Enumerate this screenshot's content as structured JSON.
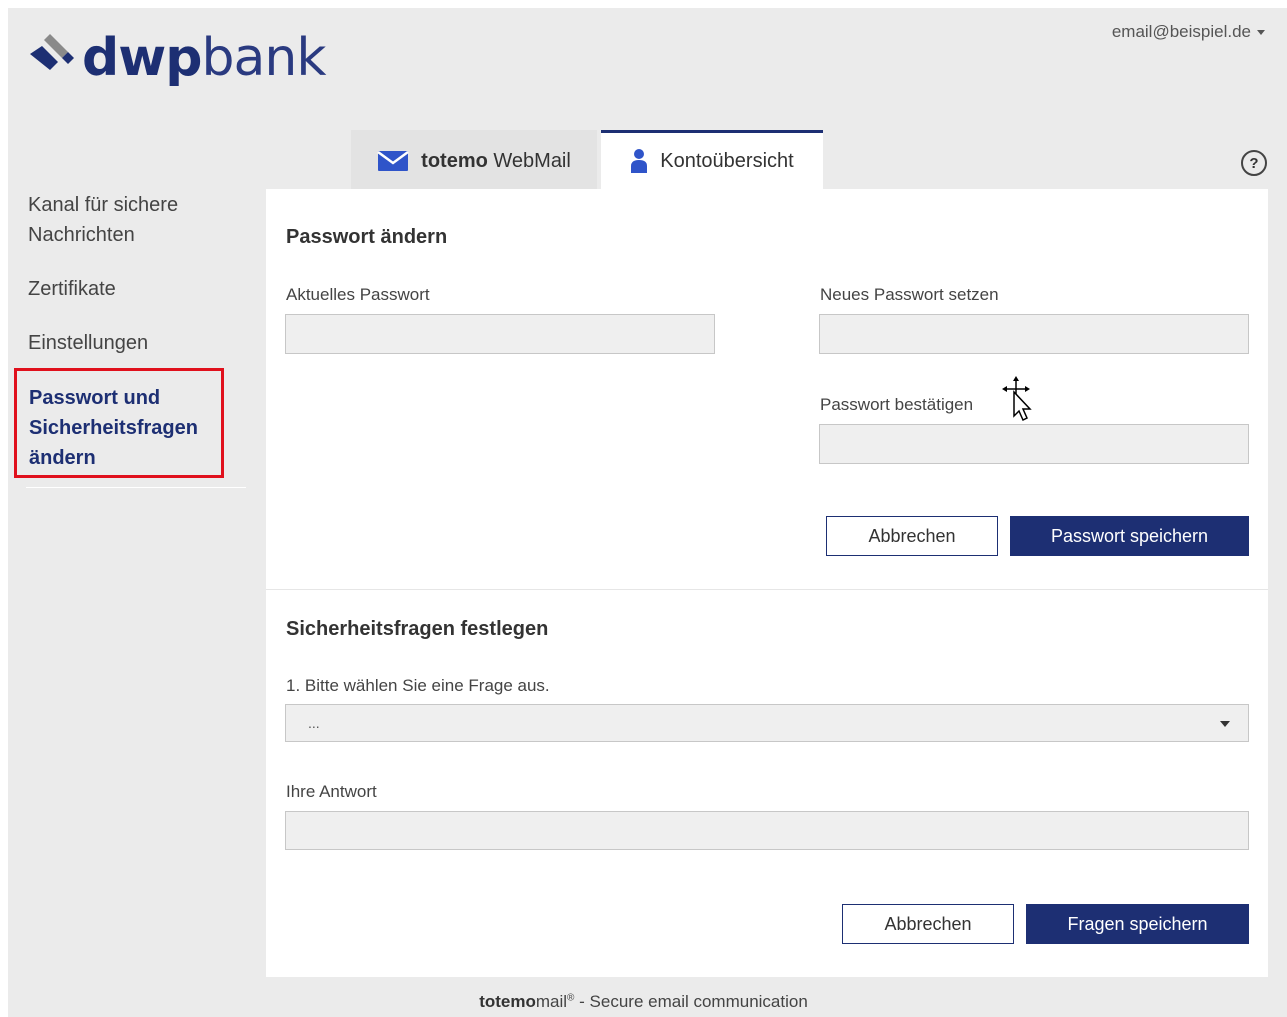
{
  "header": {
    "logo_bold": "dwp",
    "logo_light": "bank",
    "user_email": "email@beispiel.de"
  },
  "tabs": [
    {
      "bold": "totemo",
      "label": "WebMail",
      "icon": "envelope-icon"
    },
    {
      "label": "Kontoübersicht",
      "icon": "user-icon"
    }
  ],
  "help_label": "?",
  "sidebar": {
    "items": [
      {
        "label": "Kanal für sichere Nachrichten"
      },
      {
        "label": "Zertifikate"
      },
      {
        "label": "Einstellungen"
      },
      {
        "label": "Passwort und Sicherheitsfragen ändern"
      }
    ]
  },
  "password_section": {
    "title": "Passwort ändern",
    "current_label": "Aktuelles Passwort",
    "current_value": "",
    "new_label": "Neues Passwort setzen",
    "new_value": "",
    "confirm_label": "Passwort bestätigen",
    "confirm_value": "",
    "cancel_label": "Abbrechen",
    "save_label": "Passwort speichern"
  },
  "security_section": {
    "title": "Sicherheitsfragen festlegen",
    "question_label": "1. Bitte wählen Sie eine Frage aus.",
    "question_selected": "...",
    "answer_label": "Ihre Antwort",
    "answer_value": "",
    "cancel_label": "Abbrechen",
    "save_label": "Fragen speichern"
  },
  "footer": {
    "brand_bold": "totemo",
    "brand_light": "mail",
    "registered": "®",
    "separator": " - ",
    "tagline": "Secure email communication"
  },
  "colors": {
    "brand": "#1d2f73",
    "highlight": "#e0101c",
    "background": "#ebebeb"
  }
}
